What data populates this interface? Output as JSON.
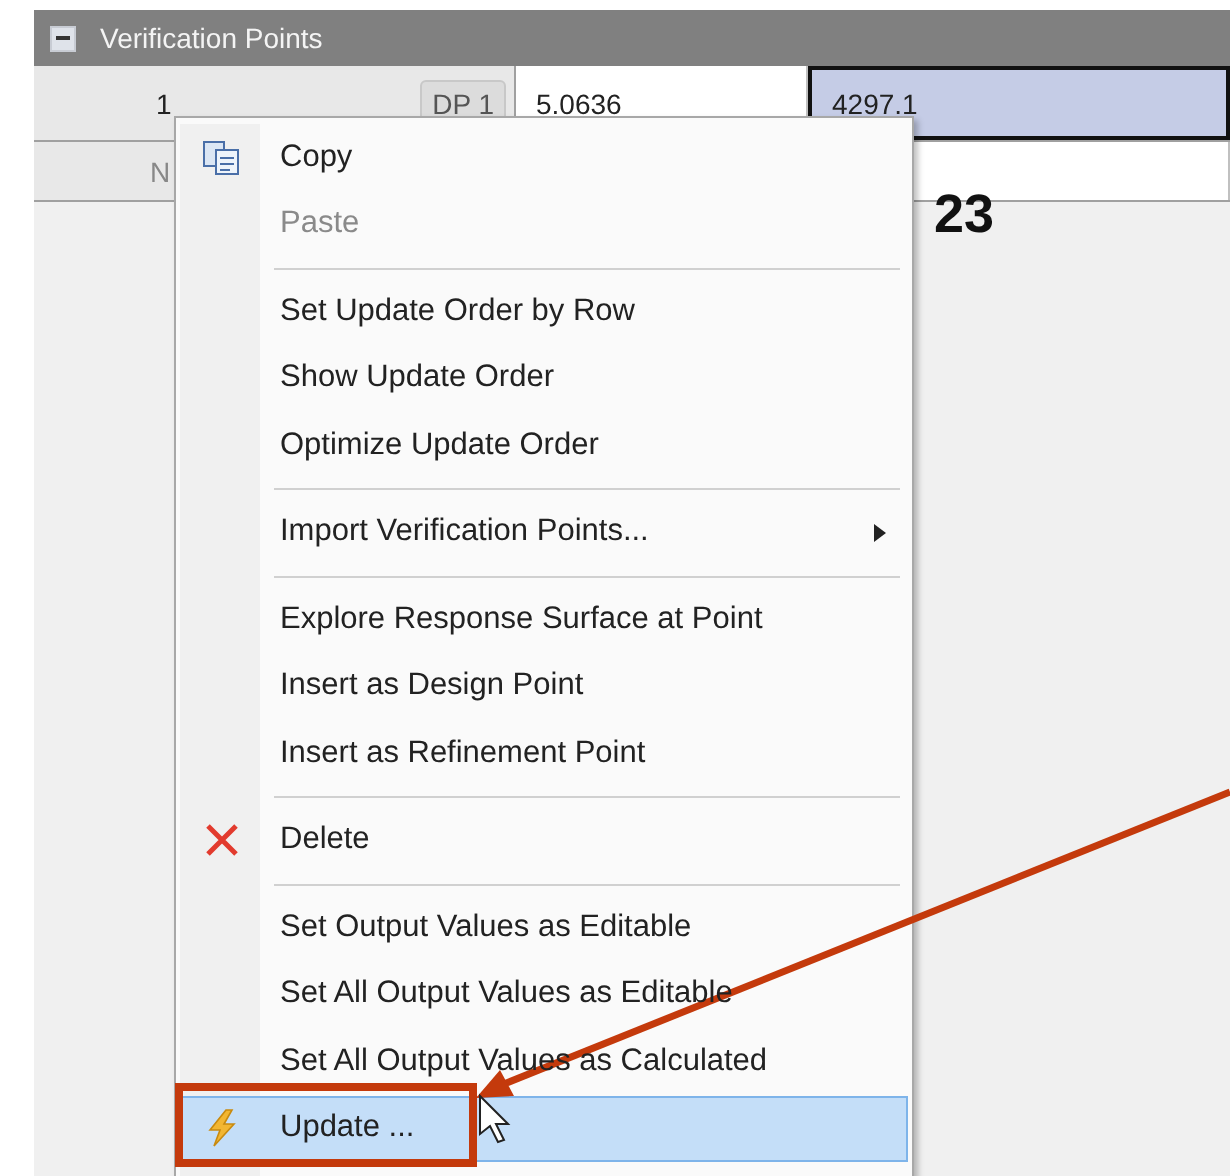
{
  "panel": {
    "title": "Verification Points",
    "collapsed": false
  },
  "rows": [
    {
      "index": "1",
      "point_button": "DP 1",
      "values": [
        "5.0636",
        "4297.1"
      ],
      "selected": true
    },
    {
      "index": "N",
      "values": [],
      "selected": false
    }
  ],
  "annotation_label": "23",
  "context_menu": {
    "items": [
      {
        "kind": "item",
        "label": "Copy",
        "disabled": false,
        "selected": false
      },
      {
        "kind": "item",
        "label": "Paste",
        "disabled": true,
        "selected": false
      },
      {
        "kind": "separator"
      },
      {
        "kind": "item",
        "label": "Set Update Order by Row",
        "disabled": false,
        "selected": false
      },
      {
        "kind": "item",
        "label": "Show Update Order",
        "disabled": false,
        "selected": false
      },
      {
        "kind": "item",
        "label": "Optimize Update Order",
        "disabled": false,
        "selected": false
      },
      {
        "kind": "separator"
      },
      {
        "kind": "submenu",
        "label": "Import Verification Points...",
        "disabled": false,
        "selected": false
      },
      {
        "kind": "separator"
      },
      {
        "kind": "item",
        "label": "Explore Response Surface at Point",
        "disabled": false,
        "selected": false
      },
      {
        "kind": "item",
        "label": "Insert as Design Point",
        "disabled": false,
        "selected": false
      },
      {
        "kind": "item",
        "label": "Insert as Refinement Point",
        "disabled": false,
        "selected": false
      },
      {
        "kind": "separator"
      },
      {
        "kind": "item",
        "label": "Delete",
        "disabled": false,
        "selected": false
      },
      {
        "kind": "separator"
      },
      {
        "kind": "item",
        "label": "Set Output Values as Editable",
        "disabled": false,
        "selected": false
      },
      {
        "kind": "item",
        "label": "Set All Output Values as Editable",
        "disabled": false,
        "selected": false
      },
      {
        "kind": "item",
        "label": "Set All Output Values as Calculated",
        "disabled": false,
        "selected": false
      },
      {
        "kind": "item",
        "label": "Update ...",
        "disabled": false,
        "selected": true
      }
    ]
  }
}
